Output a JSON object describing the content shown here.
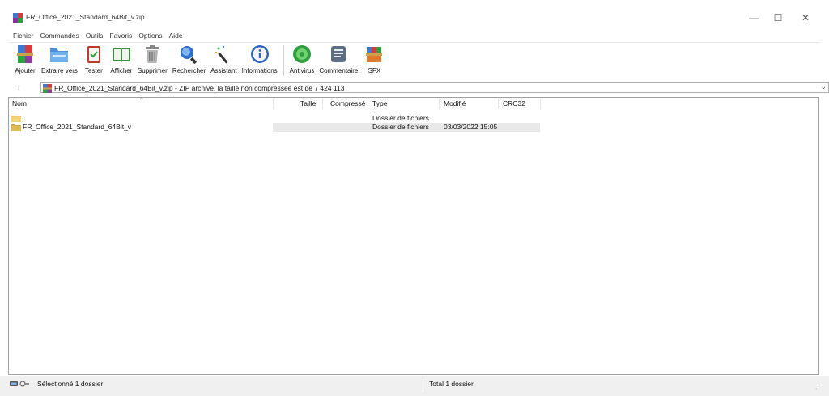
{
  "window": {
    "title": "FR_Office_2021_Standard_64Bit_v.zip",
    "controls": {
      "minimize": "—",
      "maximize": "☐",
      "close": "✕"
    }
  },
  "menubar": [
    "Fichier",
    "Commandes",
    "Outils",
    "Favoris",
    "Options",
    "Aide"
  ],
  "toolbar": {
    "group1": [
      {
        "label": "Ajouter",
        "icon": "winrar-add-icon"
      },
      {
        "label": "Extraire vers",
        "icon": "extract-folder-icon"
      },
      {
        "label": "Tester",
        "icon": "test-clipboard-icon"
      },
      {
        "label": "Afficher",
        "icon": "view-book-icon"
      },
      {
        "label": "Supprimer",
        "icon": "trash-icon"
      },
      {
        "label": "Rechercher",
        "icon": "search-magnifier-icon"
      },
      {
        "label": "Assistant",
        "icon": "wizard-wand-icon"
      },
      {
        "label": "Informations",
        "icon": "info-icon"
      }
    ],
    "group2": [
      {
        "label": "Antivirus",
        "icon": "antivirus-icon"
      },
      {
        "label": "Commentaire",
        "icon": "comment-icon"
      },
      {
        "label": "SFX",
        "icon": "sfx-icon"
      }
    ]
  },
  "address": {
    "up_arrow": "↑",
    "text": "FR_Office_2021_Standard_64Bit_v.zip - ZIP archive, la taille non compressée est de 7 424 113",
    "dropdown": "⌄"
  },
  "columns": {
    "name": "Nom",
    "size": "Taille",
    "packed": "Compressé",
    "type": "Type",
    "modified": "Modifié",
    "crc": "CRC32",
    "sort_indicator": "^"
  },
  "rows": [
    {
      "name": "..",
      "size": "",
      "packed": "",
      "type": "Dossier de fichiers",
      "modified": "",
      "crc": ""
    },
    {
      "name": "FR_Office_2021_Standard_64Bit_v",
      "size": "",
      "packed": "",
      "type": "Dossier de fichiers",
      "modified": "03/03/2022 15:05",
      "crc": ""
    }
  ],
  "status": {
    "left": "Sélectionné 1 dossier",
    "right": "Total 1 dossier"
  },
  "colors": {
    "folder": "#e8c25a",
    "selection": "#e9e9e9",
    "statusbar": "#f0f0f0"
  }
}
